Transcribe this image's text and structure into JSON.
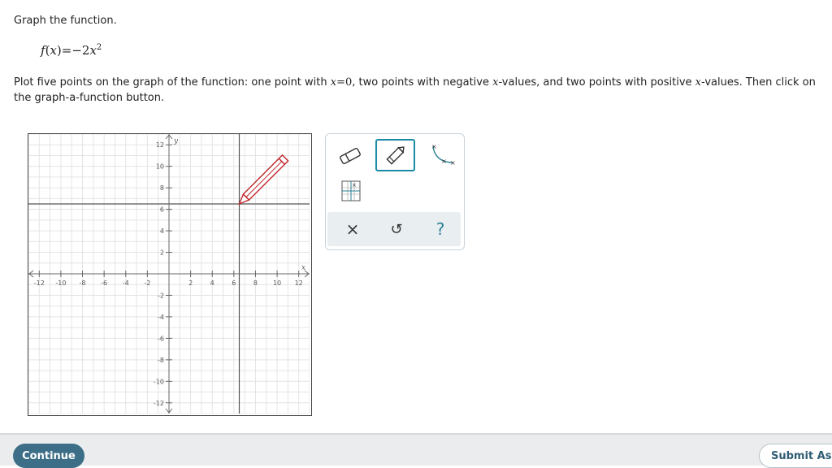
{
  "prompt": "Graph the function.",
  "formula": {
    "fname": "f",
    "arg": "x",
    "rhs": "=−2",
    "var": "x",
    "exp": "2"
  },
  "instructions": {
    "t1": "Plot five points on the graph of the function: one point with ",
    "m1": "x",
    "n1": "=0",
    "t2": ", two points with negative ",
    "m2": "x",
    "t3": "-values, and two points with positive ",
    "m3": "x",
    "t4": "-values. Then click on the graph-a-function button."
  },
  "graph": {
    "x_range": [
      -13,
      13
    ],
    "y_range": [
      -13,
      13
    ],
    "x_ticks": [
      "-12",
      "-10",
      "-8",
      "-6",
      "-4",
      "-2",
      "2",
      "4",
      "6",
      "8",
      "10",
      "12"
    ],
    "y_ticks": [
      "12",
      "10",
      "8",
      "6",
      "4",
      "2",
      "-2",
      "-4",
      "-6",
      "-8",
      "-10",
      "-12"
    ],
    "x_axis_label": "x",
    "y_axis_label": "y",
    "gridlines": true,
    "cursor": "pencil"
  },
  "toolbar": {
    "tools": [
      "eraser-icon",
      "pencil-icon",
      "parabola-tool-icon",
      "grid-point-icon"
    ],
    "selected": "pencil-icon",
    "actions": {
      "clear": "×",
      "undo": "↺",
      "help": "?"
    }
  },
  "footer": {
    "continue_label": "Continue",
    "submit_label": "Submit Ass"
  },
  "colors": {
    "accent": "#1a8aa6",
    "continue_bg": "#3c6f87",
    "pencil": "#c0262b"
  }
}
